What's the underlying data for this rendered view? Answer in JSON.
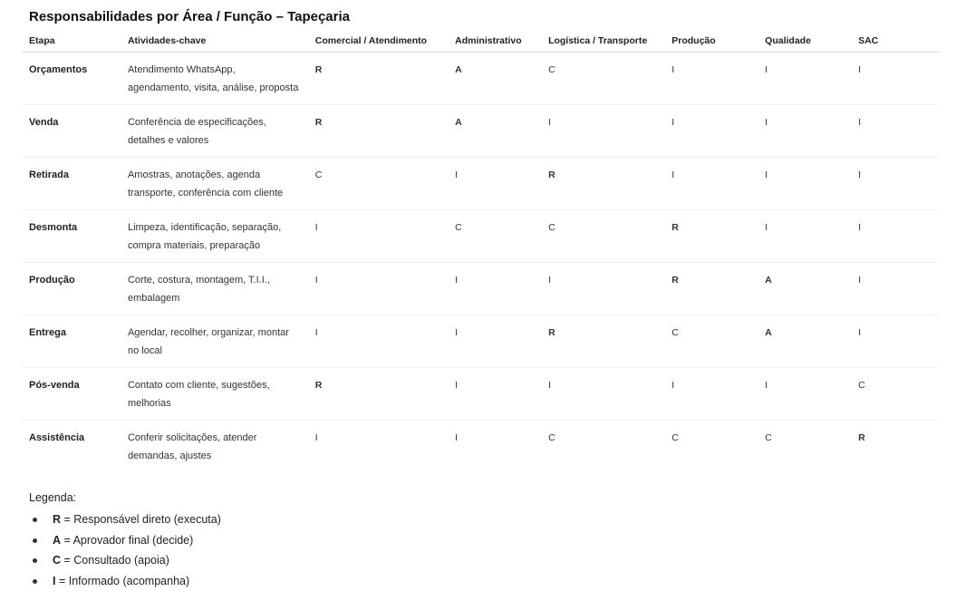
{
  "title": "Responsabilidades por Área / Função – Tapeçaria",
  "columns": [
    "Etapa",
    "Atividades-chave",
    "Comercial / Atendimento",
    "Administrativo",
    "Logística / Transporte",
    "Produção",
    "Qualidade",
    "SAC"
  ],
  "rows": [
    {
      "etapa": "Orçamentos",
      "atividades": "Atendimento WhatsApp, agendamento, visita, análise, proposta",
      "codes": [
        "R",
        "A",
        "C",
        "I",
        "I",
        "I"
      ]
    },
    {
      "etapa": "Venda",
      "atividades": "Conferência de especificações, detalhes e valores",
      "codes": [
        "R",
        "A",
        "I",
        "I",
        "I",
        "I"
      ]
    },
    {
      "etapa": "Retirada",
      "atividades": "Amostras, anotações, agenda transporte, conferência com cliente",
      "codes": [
        "C",
        "I",
        "R",
        "I",
        "I",
        "I"
      ]
    },
    {
      "etapa": "Desmonta",
      "atividades": "Limpeza, identificação, separação, compra materiais, preparação",
      "codes": [
        "I",
        "C",
        "C",
        "R",
        "I",
        "I"
      ]
    },
    {
      "etapa": "Produção",
      "atividades": "Corte, costura, montagem, T.I.I., embalagem",
      "codes": [
        "I",
        "I",
        "I",
        "R",
        "A",
        "I"
      ]
    },
    {
      "etapa": "Entrega",
      "atividades": "Agendar, recolher, organizar, montar no local",
      "codes": [
        "I",
        "I",
        "R",
        "C",
        "A",
        "I"
      ]
    },
    {
      "etapa": "Pós-venda",
      "atividades": "Contato com cliente, sugestões, melhorias",
      "codes": [
        "R",
        "I",
        "I",
        "I",
        "I",
        "C"
      ]
    },
    {
      "etapa": "Assistência",
      "atividades": "Conferir solicitações, atender demandas, ajustes",
      "codes": [
        "I",
        "I",
        "C",
        "C",
        "C",
        "R"
      ]
    }
  ],
  "legend": {
    "title": "Legenda:",
    "items": [
      {
        "key": "R",
        "text": " = Responsável direto (executa)"
      },
      {
        "key": "A",
        "text": " = Aprovador final (decide)"
      },
      {
        "key": "C",
        "text": " = Consultado (apoia)"
      },
      {
        "key": "I",
        "text": " = Informado (acompanha)"
      }
    ]
  }
}
